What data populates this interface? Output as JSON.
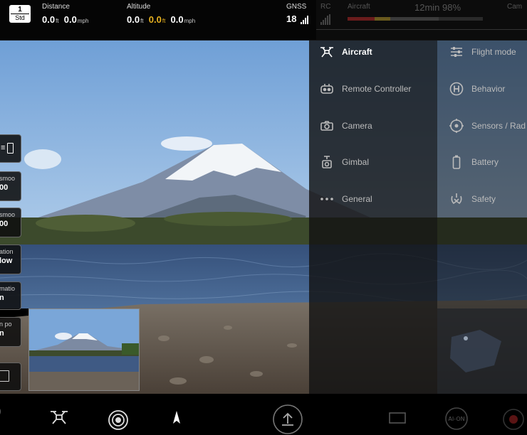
{
  "topbar": {
    "mode": {
      "number": "1",
      "label": "Std"
    },
    "distance": {
      "label": "Distance",
      "value1": "0.0",
      "unit1": "ft",
      "value2": "0.0",
      "unit2": "mph"
    },
    "altitude": {
      "label": "Altitude",
      "value1": "0.0",
      "unit1": "ft",
      "value2": "0.0",
      "unit2": "ft",
      "value3": "0.0",
      "unit3": "mph"
    },
    "gnss": {
      "label": "GNSS",
      "value": "18"
    },
    "rc": {
      "label": "RC"
    },
    "aircraft": {
      "label": "Aircraft"
    },
    "flight_time": "12min  98%",
    "camera": {
      "label": "Cam"
    }
  },
  "left_settings": [
    {
      "title": "",
      "value": ""
    },
    {
      "title": "smoo",
      "value": "00"
    },
    {
      "title": "smoo",
      "value": "00"
    },
    {
      "title": "ation",
      "value": "low"
    },
    {
      "title": "matio",
      "value": "n"
    },
    {
      "title": "n po",
      "value": "n"
    },
    {
      "title": "",
      "value": ""
    }
  ],
  "settings_menu": {
    "left": [
      {
        "label": "Aircraft",
        "icon": "drone-icon",
        "active": true
      },
      {
        "label": "Remote Controller",
        "icon": "remote-controller-icon",
        "active": false
      },
      {
        "label": "Camera",
        "icon": "camera-icon",
        "active": false
      },
      {
        "label": "Gimbal",
        "icon": "gimbal-icon",
        "active": false
      },
      {
        "label": "General",
        "icon": "more-icon",
        "active": false
      }
    ],
    "right": [
      {
        "label": "Flight mode",
        "icon": "sliders-icon"
      },
      {
        "label": "Behavior",
        "icon": "h-circle-icon"
      },
      {
        "label": "Sensors / Rad",
        "icon": "target-icon"
      },
      {
        "label": "Battery",
        "icon": "battery-icon"
      },
      {
        "label": "Safety",
        "icon": "safety-icon"
      }
    ]
  },
  "bottombar": {
    "icons": [
      "rotate-icon",
      "drone-icon",
      "shutter-icon",
      "compass-arrow-icon",
      "upload-icon",
      "frame-icon",
      "ai-on-icon",
      "record-icon"
    ],
    "ai_label": "AI-ON"
  },
  "colors": {
    "accent_amber": "#e8b220",
    "panel": "#121212",
    "battery_low": "#6a1c1c"
  }
}
